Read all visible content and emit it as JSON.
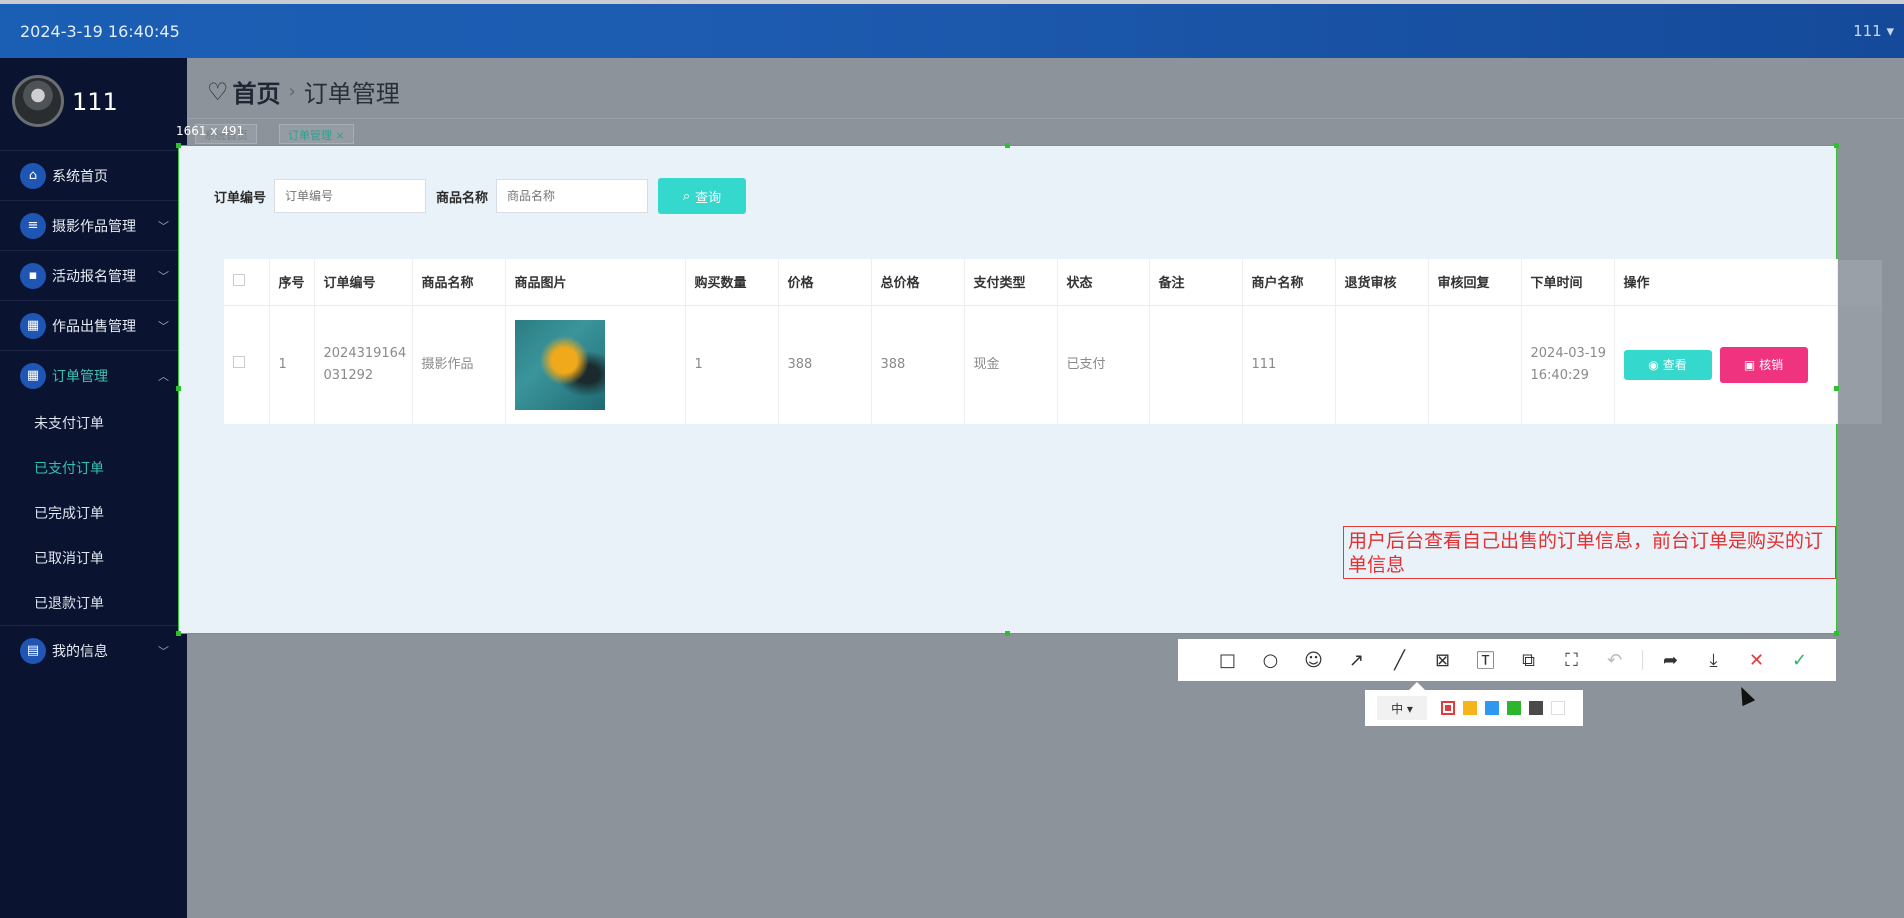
{
  "topbar": {
    "datetime": "2024-3-19 16:40:45",
    "user": "111 ▾"
  },
  "profile": {
    "name": "111"
  },
  "sidebar": {
    "items": [
      {
        "label": "系统首页",
        "icon": "home-icon",
        "glyph": "⌂"
      },
      {
        "label": "摄影作品管理",
        "icon": "sliders-icon",
        "glyph": "≡"
      },
      {
        "label": "活动报名管理",
        "icon": "chat-icon",
        "glyph": "▪"
      },
      {
        "label": "作品出售管理",
        "icon": "grid-icon",
        "glyph": "▦"
      },
      {
        "label": "订单管理",
        "icon": "grid-icon",
        "glyph": "▦"
      }
    ],
    "sub_items": [
      "未支付订单",
      "已支付订单",
      "已完成订单",
      "已取消订单",
      "已退款订单"
    ],
    "last_item": {
      "label": "我的信息",
      "icon": "card-icon",
      "glyph": "▤"
    }
  },
  "header": {
    "home": "首页",
    "separator": "›",
    "current": "订单管理"
  },
  "tabs": [
    {
      "label": "系统首页"
    },
    {
      "label": "订单管理 ×"
    }
  ],
  "selection_size": "1661 x 491",
  "search": {
    "order_no_label": "订单编号",
    "order_no_placeholder": "订单编号",
    "product_label": "商品名称",
    "product_placeholder": "商品名称",
    "button": "查询"
  },
  "table": {
    "columns": [
      "序号",
      "订单编号",
      "商品名称",
      "商品图片",
      "购买数量",
      "价格",
      "总价格",
      "支付类型",
      "状态",
      "备注",
      "商户名称",
      "退货审核",
      "审核回复",
      "下单时间",
      "操作"
    ],
    "row": {
      "index": "1",
      "order_no": "2024319164031292",
      "product": "摄影作品",
      "quantity": "1",
      "price": "388",
      "total": "388",
      "payment": "现金",
      "status": "已支付",
      "note": "",
      "merchant": "111",
      "return_review": "",
      "review_reply": "",
      "time": "2024-03-19 16:40:29",
      "view_button": "查看",
      "cancel_button": "核销"
    }
  },
  "annotation": {
    "text": "用户后台查看自己出售的订单信息，前台订单是购买的订单信息"
  },
  "toolbar": {
    "size": "中 ▾",
    "colors": [
      "#e23b3b",
      "#f5b41b",
      "#2e98f0",
      "#2db52d",
      "#4a4a4a",
      "#ffffff"
    ]
  }
}
